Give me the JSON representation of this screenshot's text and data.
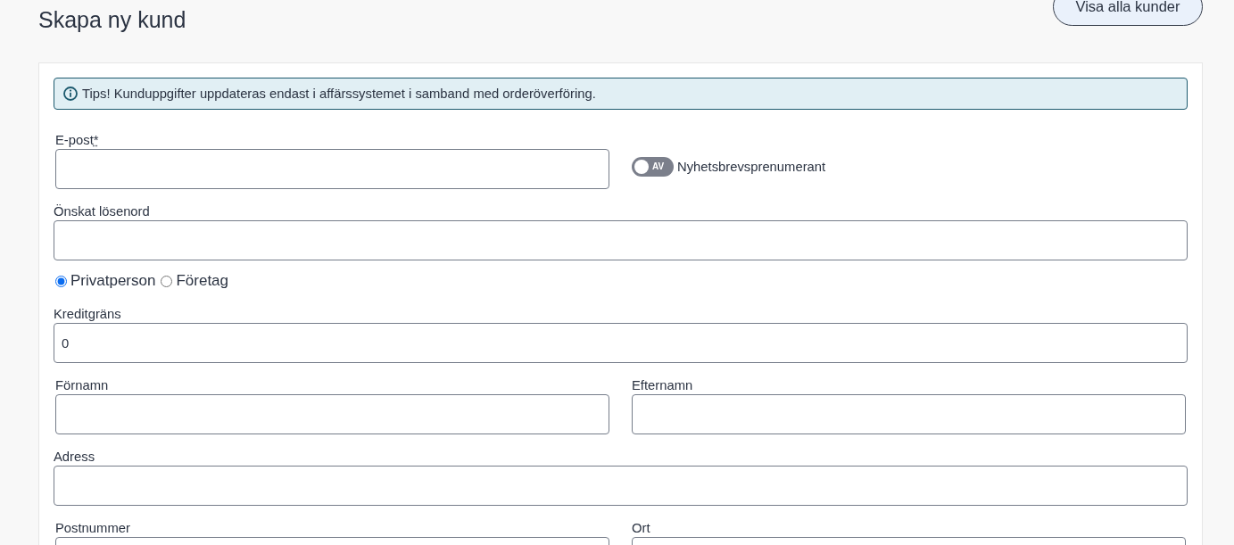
{
  "header": {
    "title": "Skapa ny kund",
    "button": "Visa alla kunder"
  },
  "alert": {
    "text": "Tips! Kunduppgifter uppdateras endast i affärssystemet i samband med orderöverföring."
  },
  "form": {
    "rows": [
      {
        "kind": "split",
        "fields": [
          {
            "label": "E-post",
            "required_mark": "*"
          }
        ],
        "toggle": {
          "state_label": "AV",
          "label": "Nyhetsbrevsprenumerant",
          "on": false
        }
      },
      {
        "kind": "full",
        "fields": [
          {
            "label": "Önskat lösenord"
          }
        ]
      },
      {
        "kind": "radios",
        "options": [
          {
            "label": "Privatperson",
            "selected": true
          },
          {
            "label": "Företag",
            "selected": false
          }
        ]
      },
      {
        "kind": "full",
        "fields": [
          {
            "label": "Kreditgräns",
            "value": "0"
          }
        ]
      },
      {
        "kind": "split",
        "fields": [
          {
            "label": "Förnamn"
          },
          {
            "label": "Efternamn"
          }
        ]
      },
      {
        "kind": "full",
        "fields": [
          {
            "label": "Adress"
          }
        ]
      },
      {
        "kind": "split",
        "fields": [
          {
            "label": "Postnummer"
          },
          {
            "label": "Ort"
          }
        ]
      }
    ]
  }
}
